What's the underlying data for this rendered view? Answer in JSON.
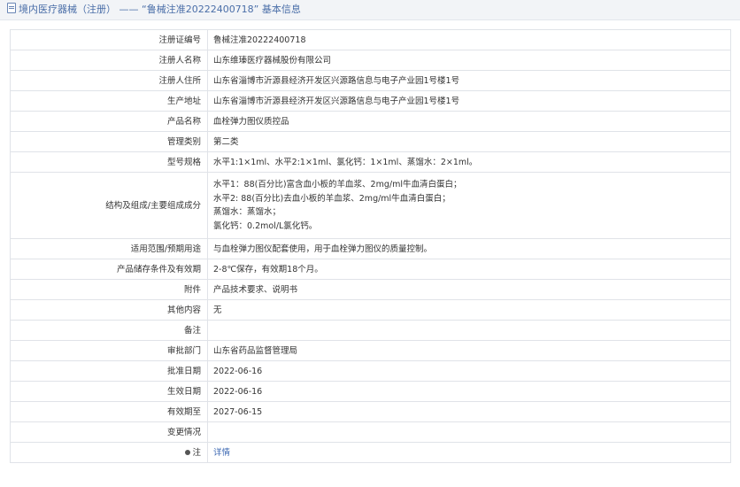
{
  "breadcrumb": {
    "section": "境内医疗器械（注册）",
    "separator": "——",
    "record": "“鲁械注准20222400718”",
    "suffix": "基本信息"
  },
  "rows": [
    {
      "key": "reg_no",
      "label": "注册证编号",
      "value": "鲁械注准20222400718"
    },
    {
      "key": "registrant",
      "label": "注册人名称",
      "value": "山东维瑧医疗器械股份有限公司"
    },
    {
      "key": "registrant_addr",
      "label": "注册人住所",
      "value": "山东省淄博市沂源县经济开发区兴源路信息与电子产业园1号楼1号"
    },
    {
      "key": "prod_addr",
      "label": "生产地址",
      "value": "山东省淄博市沂源县经济开发区兴源路信息与电子产业园1号楼1号"
    },
    {
      "key": "product_name",
      "label": "产品名称",
      "value": "血栓弹力图仪质控品"
    },
    {
      "key": "category",
      "label": "管理类别",
      "value": "第二类"
    },
    {
      "key": "model",
      "label": "型号规格",
      "value": "水平1:1×1ml、水平2:1×1ml、氯化钙：1×1ml、蒸馏水：2×1ml。"
    },
    {
      "key": "composition",
      "label": "结构及组成/主要组成成分",
      "lines": [
        "水平1：88(百分比)富含血小板的羊血浆、2mg/ml牛血清白蛋白；",
        "水平2: 88(百分比)去血小板的羊血浆、2mg/ml牛血清白蛋白；",
        "蒸馏水：蒸馏水；",
        "氯化钙：0.2mol/L氯化钙。"
      ]
    },
    {
      "key": "scope",
      "label": "适用范围/预期用途",
      "value": "与血栓弹力图仪配套使用，用于血栓弹力图仪的质量控制。"
    },
    {
      "key": "storage",
      "label": "产品储存条件及有效期",
      "value": "2-8℃保存，有效期18个月。"
    },
    {
      "key": "attachment",
      "label": "附件",
      "value": "产品技术要求、说明书"
    },
    {
      "key": "other",
      "label": "其他内容",
      "value": "无"
    },
    {
      "key": "remark",
      "label": "备注",
      "value": ""
    },
    {
      "key": "approver",
      "label": "审批部门",
      "value": "山东省药品监督管理局"
    },
    {
      "key": "approve_date",
      "label": "批准日期",
      "value": "2022-06-16"
    },
    {
      "key": "effective_date",
      "label": "生效日期",
      "value": "2022-06-16"
    },
    {
      "key": "expiry_date",
      "label": "有效期至",
      "value": "2027-06-15"
    },
    {
      "key": "change",
      "label": "变更情况",
      "value": ""
    }
  ],
  "note": {
    "label": "注",
    "icon": "pin-icon",
    "link_text": "详情"
  },
  "colors": {
    "title": "#4a6ea8",
    "link": "#3b67b2",
    "border": "#e0e3e8",
    "title_bg": "#f2f4f7"
  }
}
